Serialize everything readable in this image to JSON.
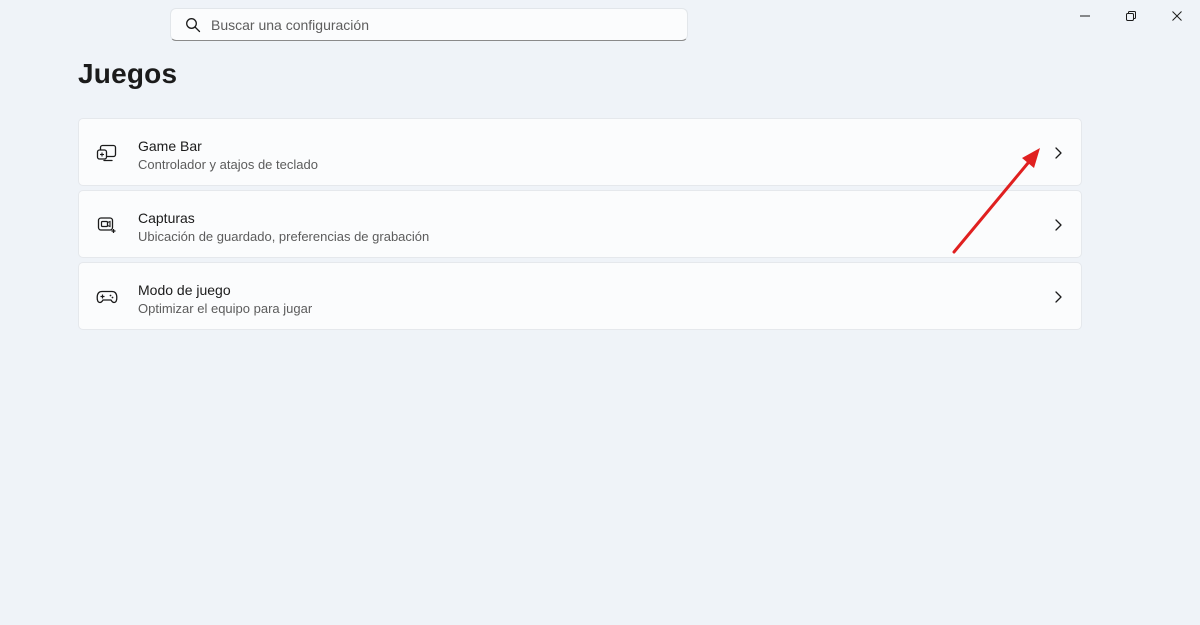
{
  "search": {
    "placeholder": "Buscar una configuración",
    "icon": "search-icon"
  },
  "window_controls": {
    "minimize": "minimize-icon",
    "maximize": "restore-icon",
    "close": "close-icon"
  },
  "page": {
    "title": "Juegos"
  },
  "items": [
    {
      "title": "Game Bar",
      "subtitle": "Controlador y atajos de teclado",
      "icon": "game-bar-icon"
    },
    {
      "title": "Capturas",
      "subtitle": "Ubicación de guardado, preferencias de grabación",
      "icon": "captures-icon"
    },
    {
      "title": "Modo de juego",
      "subtitle": "Optimizar el equipo para jugar",
      "icon": "gamepad-icon"
    }
  ],
  "annotation": {
    "arrow_color": "#e02020"
  }
}
